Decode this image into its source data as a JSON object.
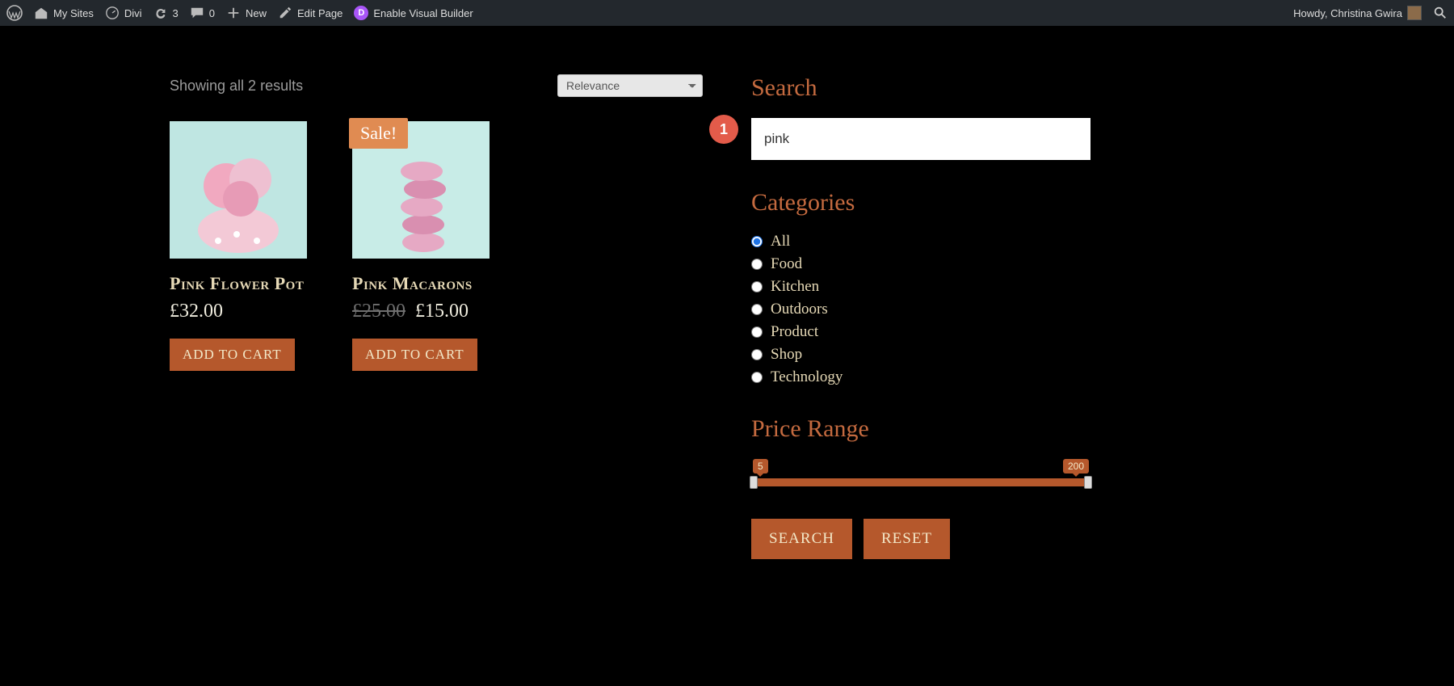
{
  "adminbar": {
    "my_sites": "My Sites",
    "site_name": "Divi",
    "updates": "3",
    "comments": "0",
    "new_label": "New",
    "edit_page": "Edit Page",
    "visual_builder": "Enable Visual Builder",
    "howdy": "Howdy, Christina Gwira"
  },
  "shop": {
    "result_count": "Showing all 2 results",
    "orderby_selected": "Relevance",
    "add_to_cart_label": "ADD TO CART",
    "sale_label": "Sale!",
    "products": [
      {
        "title": "Pink Flower Pot",
        "price": "£32.00",
        "old_price": "",
        "on_sale": false
      },
      {
        "title": "Pink Macarons",
        "price": "£15.00",
        "old_price": "£25.00",
        "on_sale": true
      }
    ]
  },
  "sidebar": {
    "annotation_badge": "1",
    "search_title": "Search",
    "search_value": "pink",
    "categories_title": "Categories",
    "categories": [
      {
        "label": "All",
        "checked": true
      },
      {
        "label": "Food",
        "checked": false
      },
      {
        "label": "Kitchen",
        "checked": false
      },
      {
        "label": "Outdoors",
        "checked": false
      },
      {
        "label": "Product",
        "checked": false
      },
      {
        "label": "Shop",
        "checked": false
      },
      {
        "label": "Technology",
        "checked": false
      }
    ],
    "price_title": "Price Range",
    "price_min": "5",
    "price_max": "200",
    "search_btn": "SEARCH",
    "reset_btn": "RESET"
  }
}
